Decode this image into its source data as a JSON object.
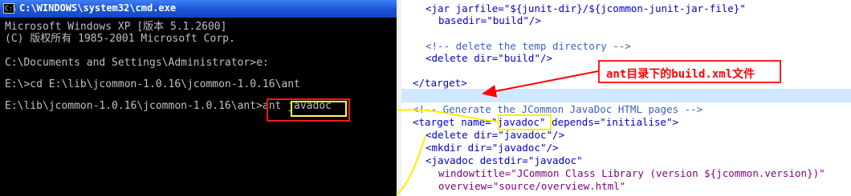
{
  "cmd": {
    "title": "C:\\WINDOWS\\system32\\cmd.exe",
    "lines": [
      "Microsoft Windows XP [版本 5.1.2600]",
      "(C) 版权所有 1985-2001 Microsoft Corp.",
      "",
      "C:\\Documents and Settings\\Administrator>e:",
      "",
      "E:\\>cd E:\\lib\\jcommon-1.0.16\\jcommon-1.0.16\\ant",
      "",
      "E:\\lib\\jcommon-1.0.16\\jcommon-1.0.16\\ant>ant javadoc"
    ],
    "icon": "console-icon"
  },
  "editor": {
    "lines": [
      "<jar jarfile=\"${junit-dir}/${jcommon-junit-jar-file}\"",
      "basedir=\"build\"/>",
      "",
      "<!-- delete the temp directory -->",
      "<delete dir=\"build\"/>",
      "",
      "</target>",
      "",
      "<!-- Generate the JCommon JavaDoc HTML pages -->",
      "<target name=\"javadoc\" depends=\"initialise\">",
      "<delete dir=\"javadoc\"/>",
      "<mkdir dir=\"javadoc\"/>",
      "<javadoc destdir=\"javadoc\"",
      "windowtitle=\"JCommon Class Library (version ${jcommon.version})\"",
      "overview=\"source/overview.html\""
    ]
  },
  "annotation": {
    "text": "ant目录下的build.xml文件",
    "color": "#ff0000"
  },
  "colors": {
    "highlight_red": "#ff1818",
    "highlight_yellow": "#ffff40",
    "title_bar": "#1b54d6"
  }
}
